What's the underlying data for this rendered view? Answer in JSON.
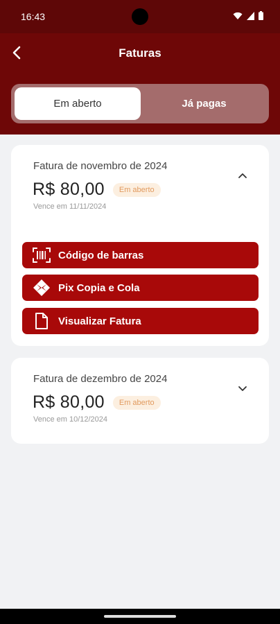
{
  "status_bar": {
    "time": "16:43"
  },
  "header": {
    "title": "Faturas"
  },
  "tabs": [
    {
      "label": "Em aberto",
      "active": true
    },
    {
      "label": "Já pagas",
      "active": false
    }
  ],
  "invoices": [
    {
      "title": "Fatura de novembro de 2024",
      "amount": "R$ 80,00",
      "status": "Em aberto",
      "due": "Vence em 11/11/2024",
      "expanded": true,
      "actions": [
        {
          "label": "Código de barras",
          "icon": "barcode-icon"
        },
        {
          "label": "Pix Copia e Cola",
          "icon": "pix-icon"
        },
        {
          "label": "Visualizar Fatura",
          "icon": "document-icon"
        }
      ]
    },
    {
      "title": "Fatura de dezembro de 2024",
      "amount": "R$ 80,00",
      "status": "Em aberto",
      "due": "Vence em 10/12/2024",
      "expanded": false
    }
  ],
  "colors": {
    "status_bar_bg": "#5e0707",
    "header_bg": "#6e0707",
    "action_button": "#a80909",
    "badge_bg": "#fcefe0",
    "badge_text": "#e19a5e",
    "page_bg": "#f1f2f4"
  }
}
